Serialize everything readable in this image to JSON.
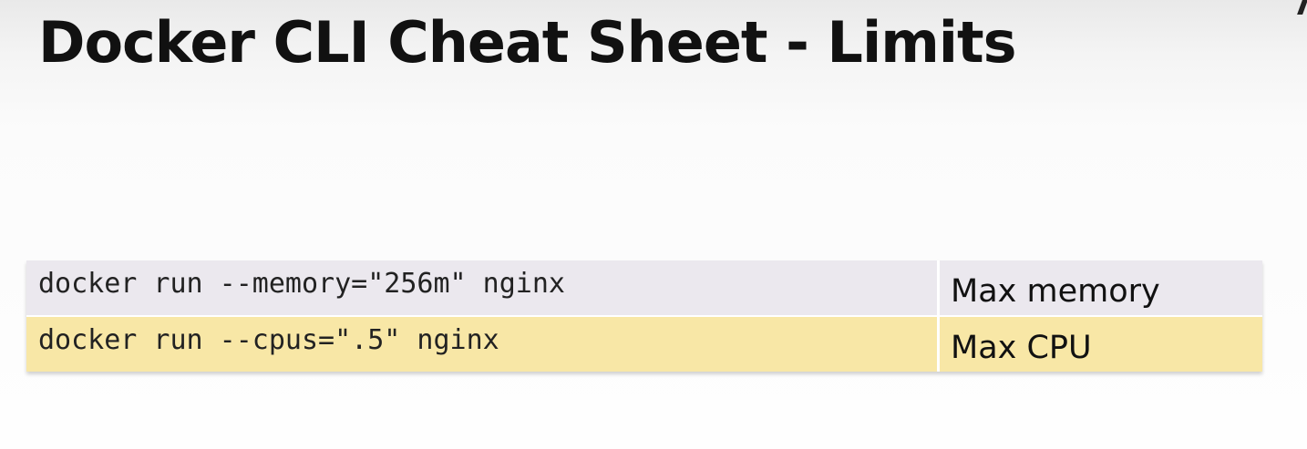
{
  "slide": {
    "title": "Docker CLI Cheat Sheet - Limits"
  },
  "table": {
    "rows": [
      {
        "command": "docker run --memory=\"256m\" nginx",
        "description": "Max memory"
      },
      {
        "command": "docker run --cpus=\".5\" nginx",
        "description": "Max CPU"
      }
    ]
  },
  "colors": {
    "row_0_background": "#ebe8ee",
    "row_1_background": "#f8e7a6"
  }
}
